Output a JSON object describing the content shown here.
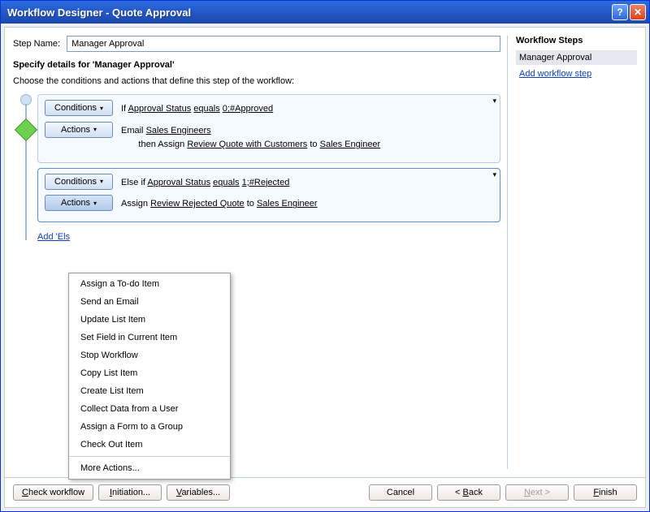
{
  "window": {
    "title": "Workflow Designer - Quote Approval"
  },
  "main": {
    "step_name_label": "Step Name:",
    "step_name_value": "Manager Approval",
    "section_title": "Specify details for 'Manager Approval'",
    "instruction": "Choose the conditions and actions that define this step of the workflow:",
    "branches": [
      {
        "conditions_btn": "Conditions",
        "actions_btn": "Actions",
        "cond_prefix": "If",
        "cond_field": "Approval Status",
        "cond_op": "equals",
        "cond_value": "0;#Approved",
        "action1_pre": "Email",
        "action1_link": "Sales Engineers",
        "action2_pre": "then Assign",
        "action2_link1": "Review Quote with Customers",
        "action2_mid": "to",
        "action2_link2": "Sales Engineer"
      },
      {
        "conditions_btn": "Conditions",
        "actions_btn": "Actions",
        "cond_prefix": "Else if",
        "cond_field": "Approval Status",
        "cond_op": "equals",
        "cond_value": "1;#Rejected",
        "action1_pre": "Assign",
        "action1_link1": "Review Rejected Quote",
        "action1_mid": "to",
        "action1_link2": "Sales Engineer"
      }
    ],
    "add_branch_label": "Add 'Else If' Conditional Branch"
  },
  "menu": {
    "items": [
      "Assign a To-do Item",
      "Send an Email",
      "Update List Item",
      "Set Field in Current Item",
      "Stop Workflow",
      "Copy List Item",
      "Create List Item",
      "Collect Data from a User",
      "Assign a Form to a Group",
      "Check Out Item"
    ],
    "more": "More Actions..."
  },
  "sidebar": {
    "heading": "Workflow Steps",
    "items": [
      "Manager Approval"
    ],
    "add_link": "Add workflow step"
  },
  "buttons": {
    "check": "Check workflow",
    "initiation": "Initiation...",
    "variables": "Variables...",
    "cancel": "Cancel",
    "back": "< Back",
    "next": "Next >",
    "finish": "Finish"
  }
}
